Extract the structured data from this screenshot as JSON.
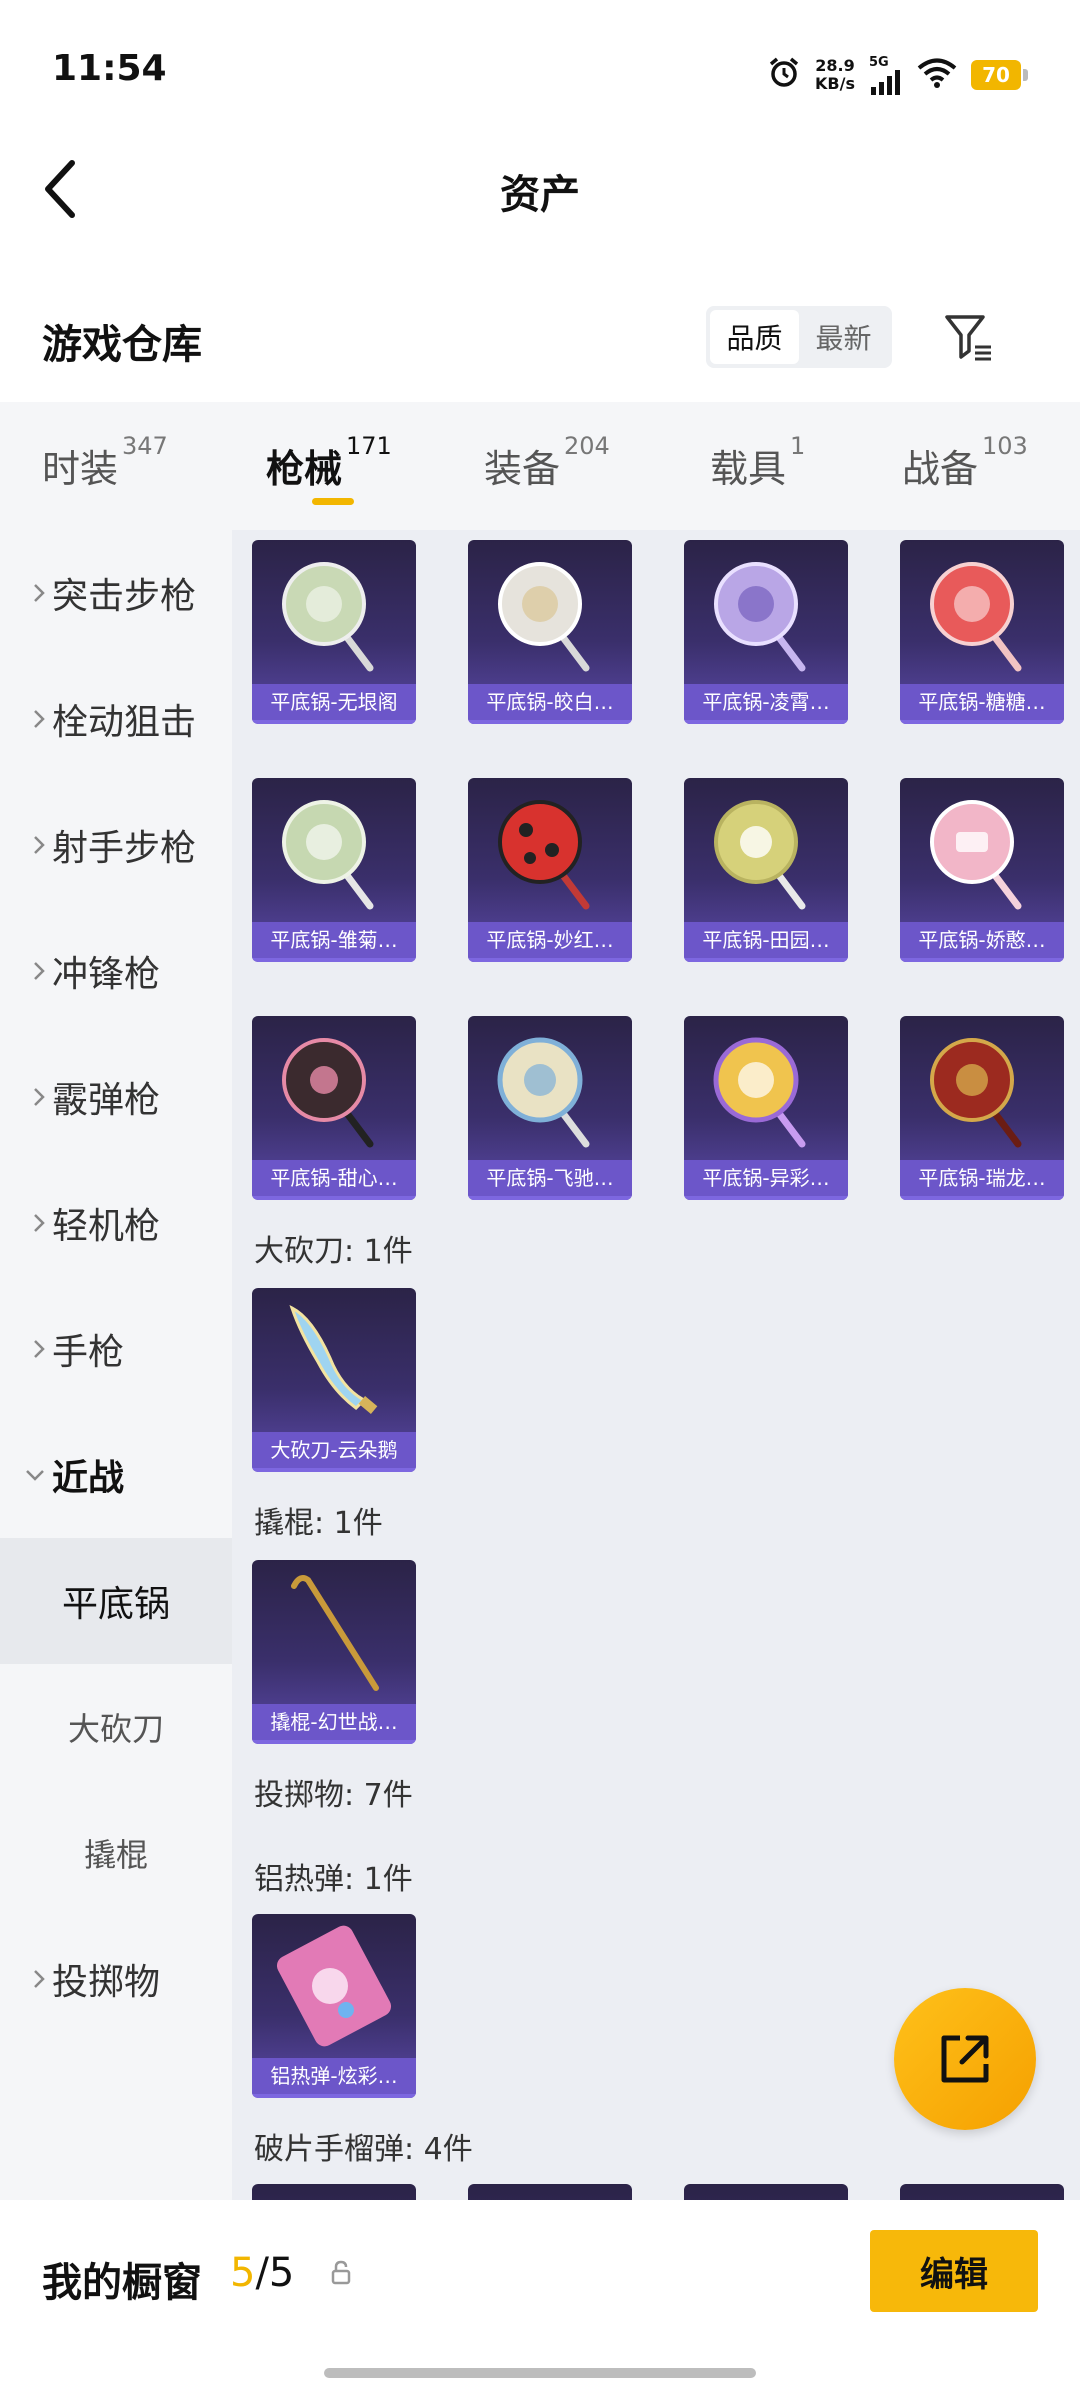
{
  "status_bar": {
    "time": "11:54",
    "net_speed_value": "28.9",
    "net_speed_unit": "KB/s",
    "network": "5G",
    "battery": "70"
  },
  "header": {
    "title": "资产"
  },
  "warehouse": {
    "title": "游戏仓库",
    "sort_options": [
      "品质",
      "最新"
    ],
    "sort_selected": "品质"
  },
  "tabs": [
    {
      "label": "时装",
      "count": "347"
    },
    {
      "label": "枪械",
      "count": "171",
      "active": true
    },
    {
      "label": "装备",
      "count": "204"
    },
    {
      "label": "载具",
      "count": "1"
    },
    {
      "label": "战备",
      "count": "103"
    }
  ],
  "sidebar": {
    "items": [
      "突击步枪",
      "栓动狙击",
      "射手步枪",
      "冲锋枪",
      "霰弹枪",
      "轻机枪",
      "手枪",
      "近战"
    ],
    "sub_items": [
      "平底锅",
      "大砍刀",
      "撬棍"
    ],
    "after_item": "投掷物",
    "active_sub": "平底锅"
  },
  "content": {
    "pan_items": [
      {
        "name": "平底锅-无垠阁",
        "color": "#c9d9b5"
      },
      {
        "name": "平底锅-皎白…",
        "color": "#e6e3dc"
      },
      {
        "name": "平底锅-凌霄…",
        "color": "#b9a6e6"
      },
      {
        "name": "平底锅-糖糖…",
        "color": "#e85a5a"
      },
      {
        "name": "平底锅-雏菊…",
        "color": "#c6d8b1"
      },
      {
        "name": "平底锅-妙红…",
        "color": "#d8322e"
      },
      {
        "name": "平底锅-田园…",
        "color": "#d6d17a"
      },
      {
        "name": "平底锅-娇憨…",
        "color": "#f2b6c8"
      },
      {
        "name": "平底锅-甜心…",
        "color": "#3b2a2e"
      },
      {
        "name": "平底锅-飞驰…",
        "color": "#e9e2c4"
      },
      {
        "name": "平底锅-异彩…",
        "color": "#f0c44e"
      },
      {
        "name": "平底锅-瑞龙…",
        "color": "#9c2a1f"
      }
    ],
    "machete_label": "大砍刀: 1件",
    "machete_item": "大砍刀-云朵鹅",
    "crowbar_label": "撬棍: 1件",
    "crowbar_item": "撬棍-幻世战…",
    "throwable_label": "投掷物: 7件",
    "thermite_label": "铝热弹: 1件",
    "thermite_item": "铝热弹-炫彩…",
    "frag_label": "破片手榴弹: 4件"
  },
  "bottom_bar": {
    "showcase_label": "我的橱窗",
    "showcase_current": "5",
    "showcase_total": "/5",
    "edit_label": "编辑"
  }
}
